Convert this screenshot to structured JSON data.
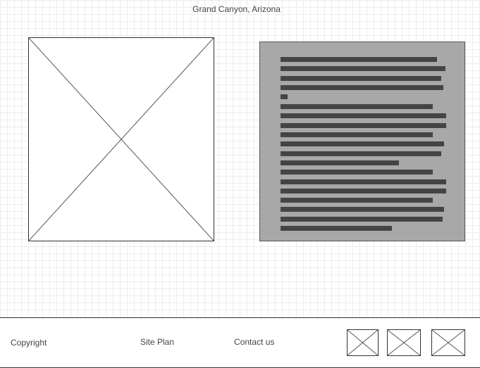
{
  "header": {
    "title": "Grand Canyon, Arizona"
  },
  "main": {
    "image": {
      "icon": "image-placeholder-icon"
    },
    "text_block": {
      "lines": 19
    }
  },
  "footer": {
    "copyright_label": "Copyright",
    "site_plan_label": "Site Plan",
    "contact_label": "Contact us",
    "social_icons": [
      "image-placeholder-icon",
      "image-placeholder-icon",
      "image-placeholder-icon"
    ]
  },
  "colors": {
    "text_block_background": "#a8a8a8",
    "text_line": "#444444",
    "grid": "#ececec",
    "border": "#333333"
  }
}
